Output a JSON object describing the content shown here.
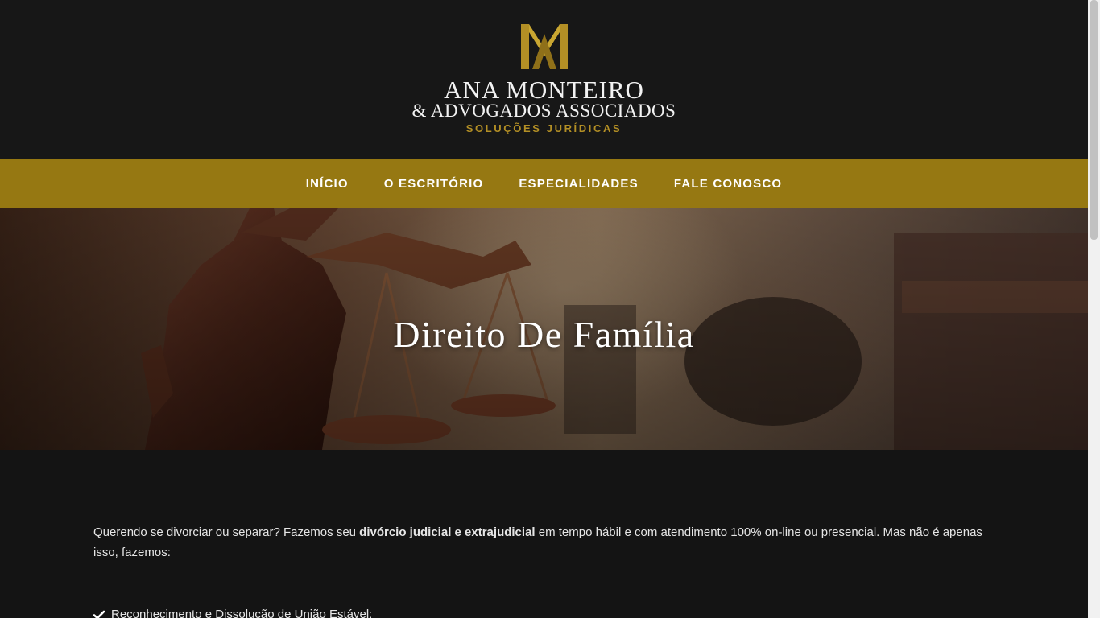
{
  "header": {
    "brand_line1": "ANA MONTEIRO",
    "brand_line2": "& ADVOGADOS ASSOCIADOS",
    "brand_line3": "SOLUÇÕES JURÍDICAS",
    "logo_icon": "am-monogram-logo",
    "brand_color": "#b38f25"
  },
  "nav": {
    "items": [
      {
        "label": "INÍCIO"
      },
      {
        "label": "O ESCRITÓRIO"
      },
      {
        "label": "ESPECIALIDADES"
      },
      {
        "label": "FALE CONOSCO"
      }
    ],
    "background": "#967812"
  },
  "hero": {
    "title": "Direito De Família"
  },
  "content": {
    "intro_part1": "Querendo se divorciar ou separar? Fazemos seu ",
    "intro_bold": "divórcio judicial e extrajudicial",
    "intro_part2": " em tempo hábil e com atendimento 100% on-line ou presencial. Mas não é apenas isso, fazemos:",
    "list": [
      {
        "icon": "check-icon",
        "text": "Reconhecimento e Dissolução de União Estável;"
      }
    ]
  }
}
